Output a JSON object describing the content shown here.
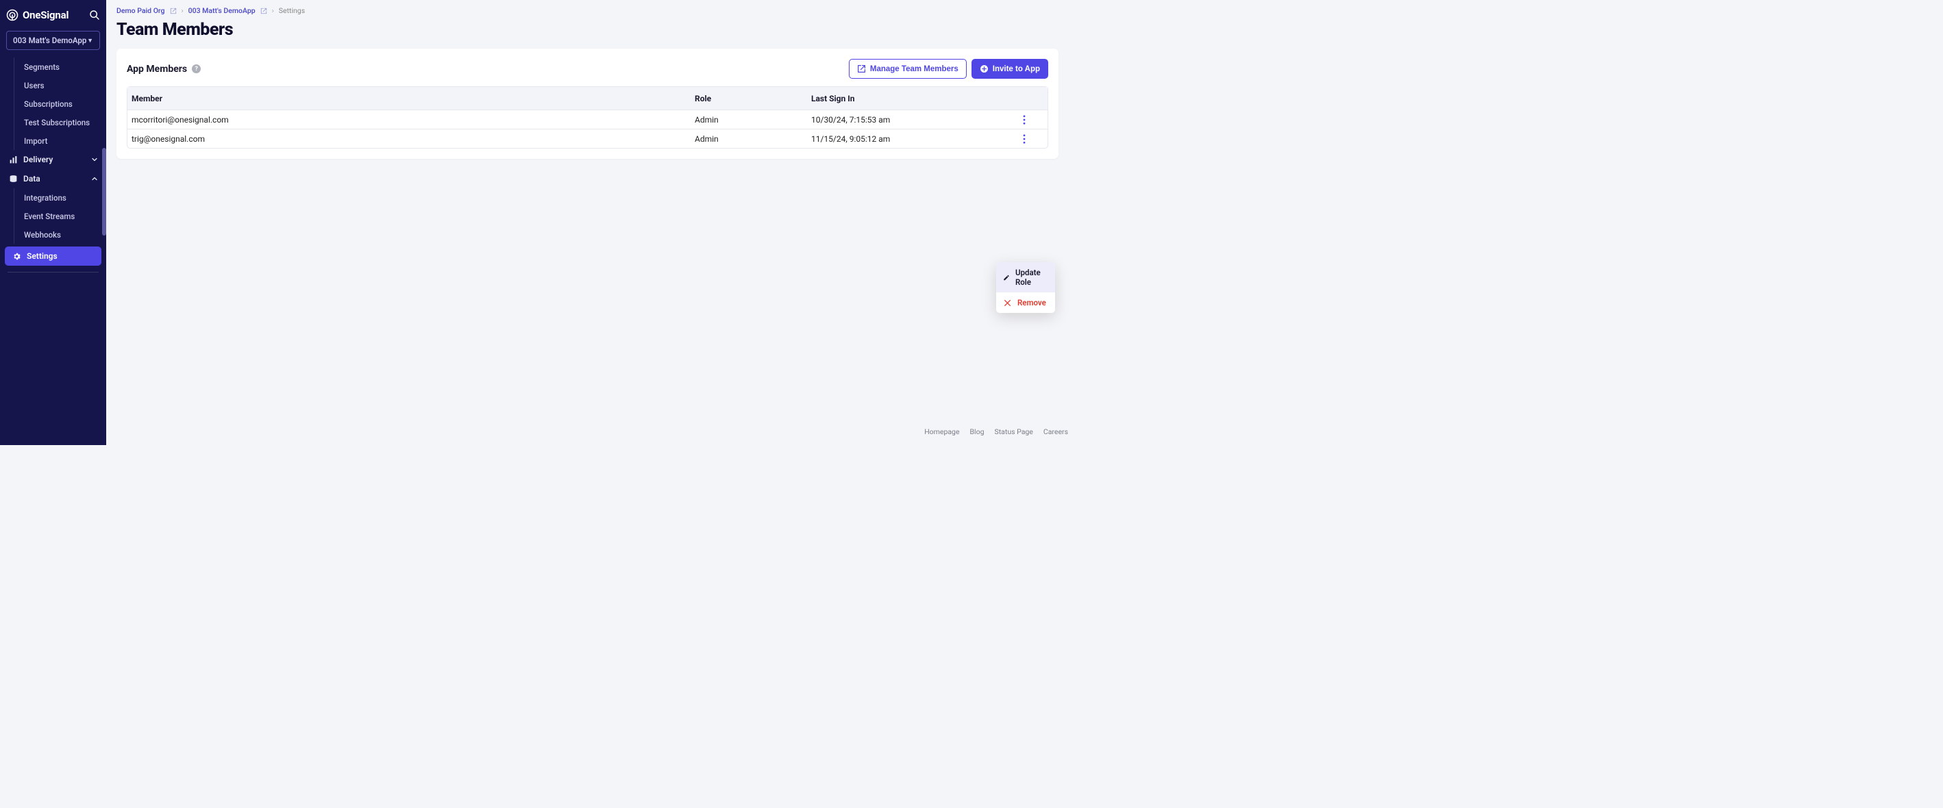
{
  "brand": {
    "name": "OneSignal"
  },
  "app_selector": {
    "label": "003 Matt's DemoApp"
  },
  "sidebar": {
    "items_top": [
      {
        "label": "Segments"
      },
      {
        "label": "Users"
      },
      {
        "label": "Subscriptions"
      },
      {
        "label": "Test Subscriptions"
      },
      {
        "label": "Import"
      }
    ],
    "delivery": {
      "label": "Delivery"
    },
    "data": {
      "label": "Data",
      "items": [
        {
          "label": "Integrations"
        },
        {
          "label": "Event Streams"
        },
        {
          "label": "Webhooks"
        }
      ]
    },
    "settings": {
      "label": "Settings"
    }
  },
  "breadcrumbs": {
    "org": "Demo Paid Org",
    "app": "003 Matt's DemoApp",
    "current": "Settings"
  },
  "page": {
    "title": "Team Members"
  },
  "card": {
    "title": "App Members",
    "manage_btn": "Manage Team Members",
    "invite_btn": "Invite to App"
  },
  "table": {
    "headers": {
      "member": "Member",
      "role": "Role",
      "last_sign_in": "Last Sign In"
    },
    "rows": [
      {
        "member": "mcorritori@onesignal.com",
        "role": "Admin",
        "last_sign_in": "10/30/24, 7:15:53 am"
      },
      {
        "member": "trig@onesignal.com",
        "role": "Admin",
        "last_sign_in": "11/15/24, 9:05:12 am"
      }
    ]
  },
  "popup": {
    "update": "Update Role",
    "remove": "Remove"
  },
  "footer": {
    "links": [
      "Homepage",
      "Blog",
      "Status Page",
      "Careers"
    ]
  }
}
